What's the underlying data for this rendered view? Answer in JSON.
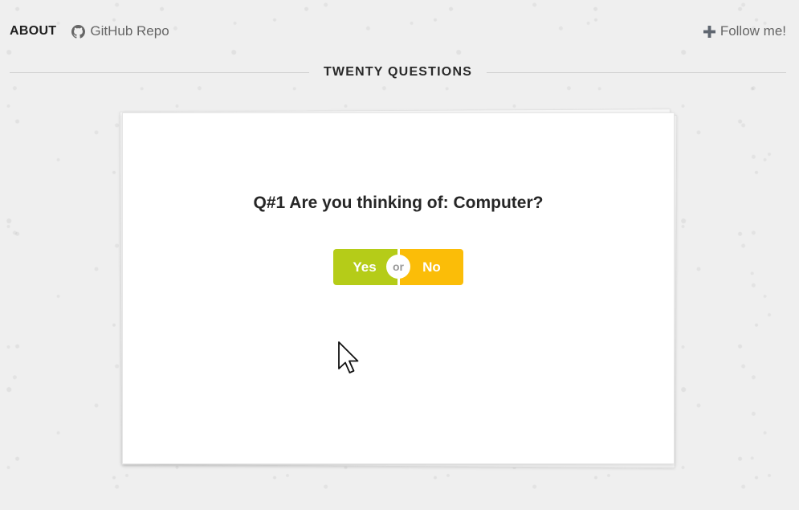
{
  "nav": {
    "about_label": "ABOUT",
    "github_label": "GitHub Repo",
    "follow_label": "Follow me!"
  },
  "section": {
    "title": "TWENTY QUESTIONS"
  },
  "card": {
    "question": "Q#1 Are you thinking of: Computer?",
    "yes_label": "Yes",
    "or_label": "or",
    "no_label": "No"
  },
  "colors": {
    "yes": "#b5cc18",
    "no": "#fbbd08",
    "background": "#efefef"
  },
  "icons": {
    "github": "github-icon",
    "follow": "plus-icon",
    "cursor": "mouse-pointer-icon"
  }
}
